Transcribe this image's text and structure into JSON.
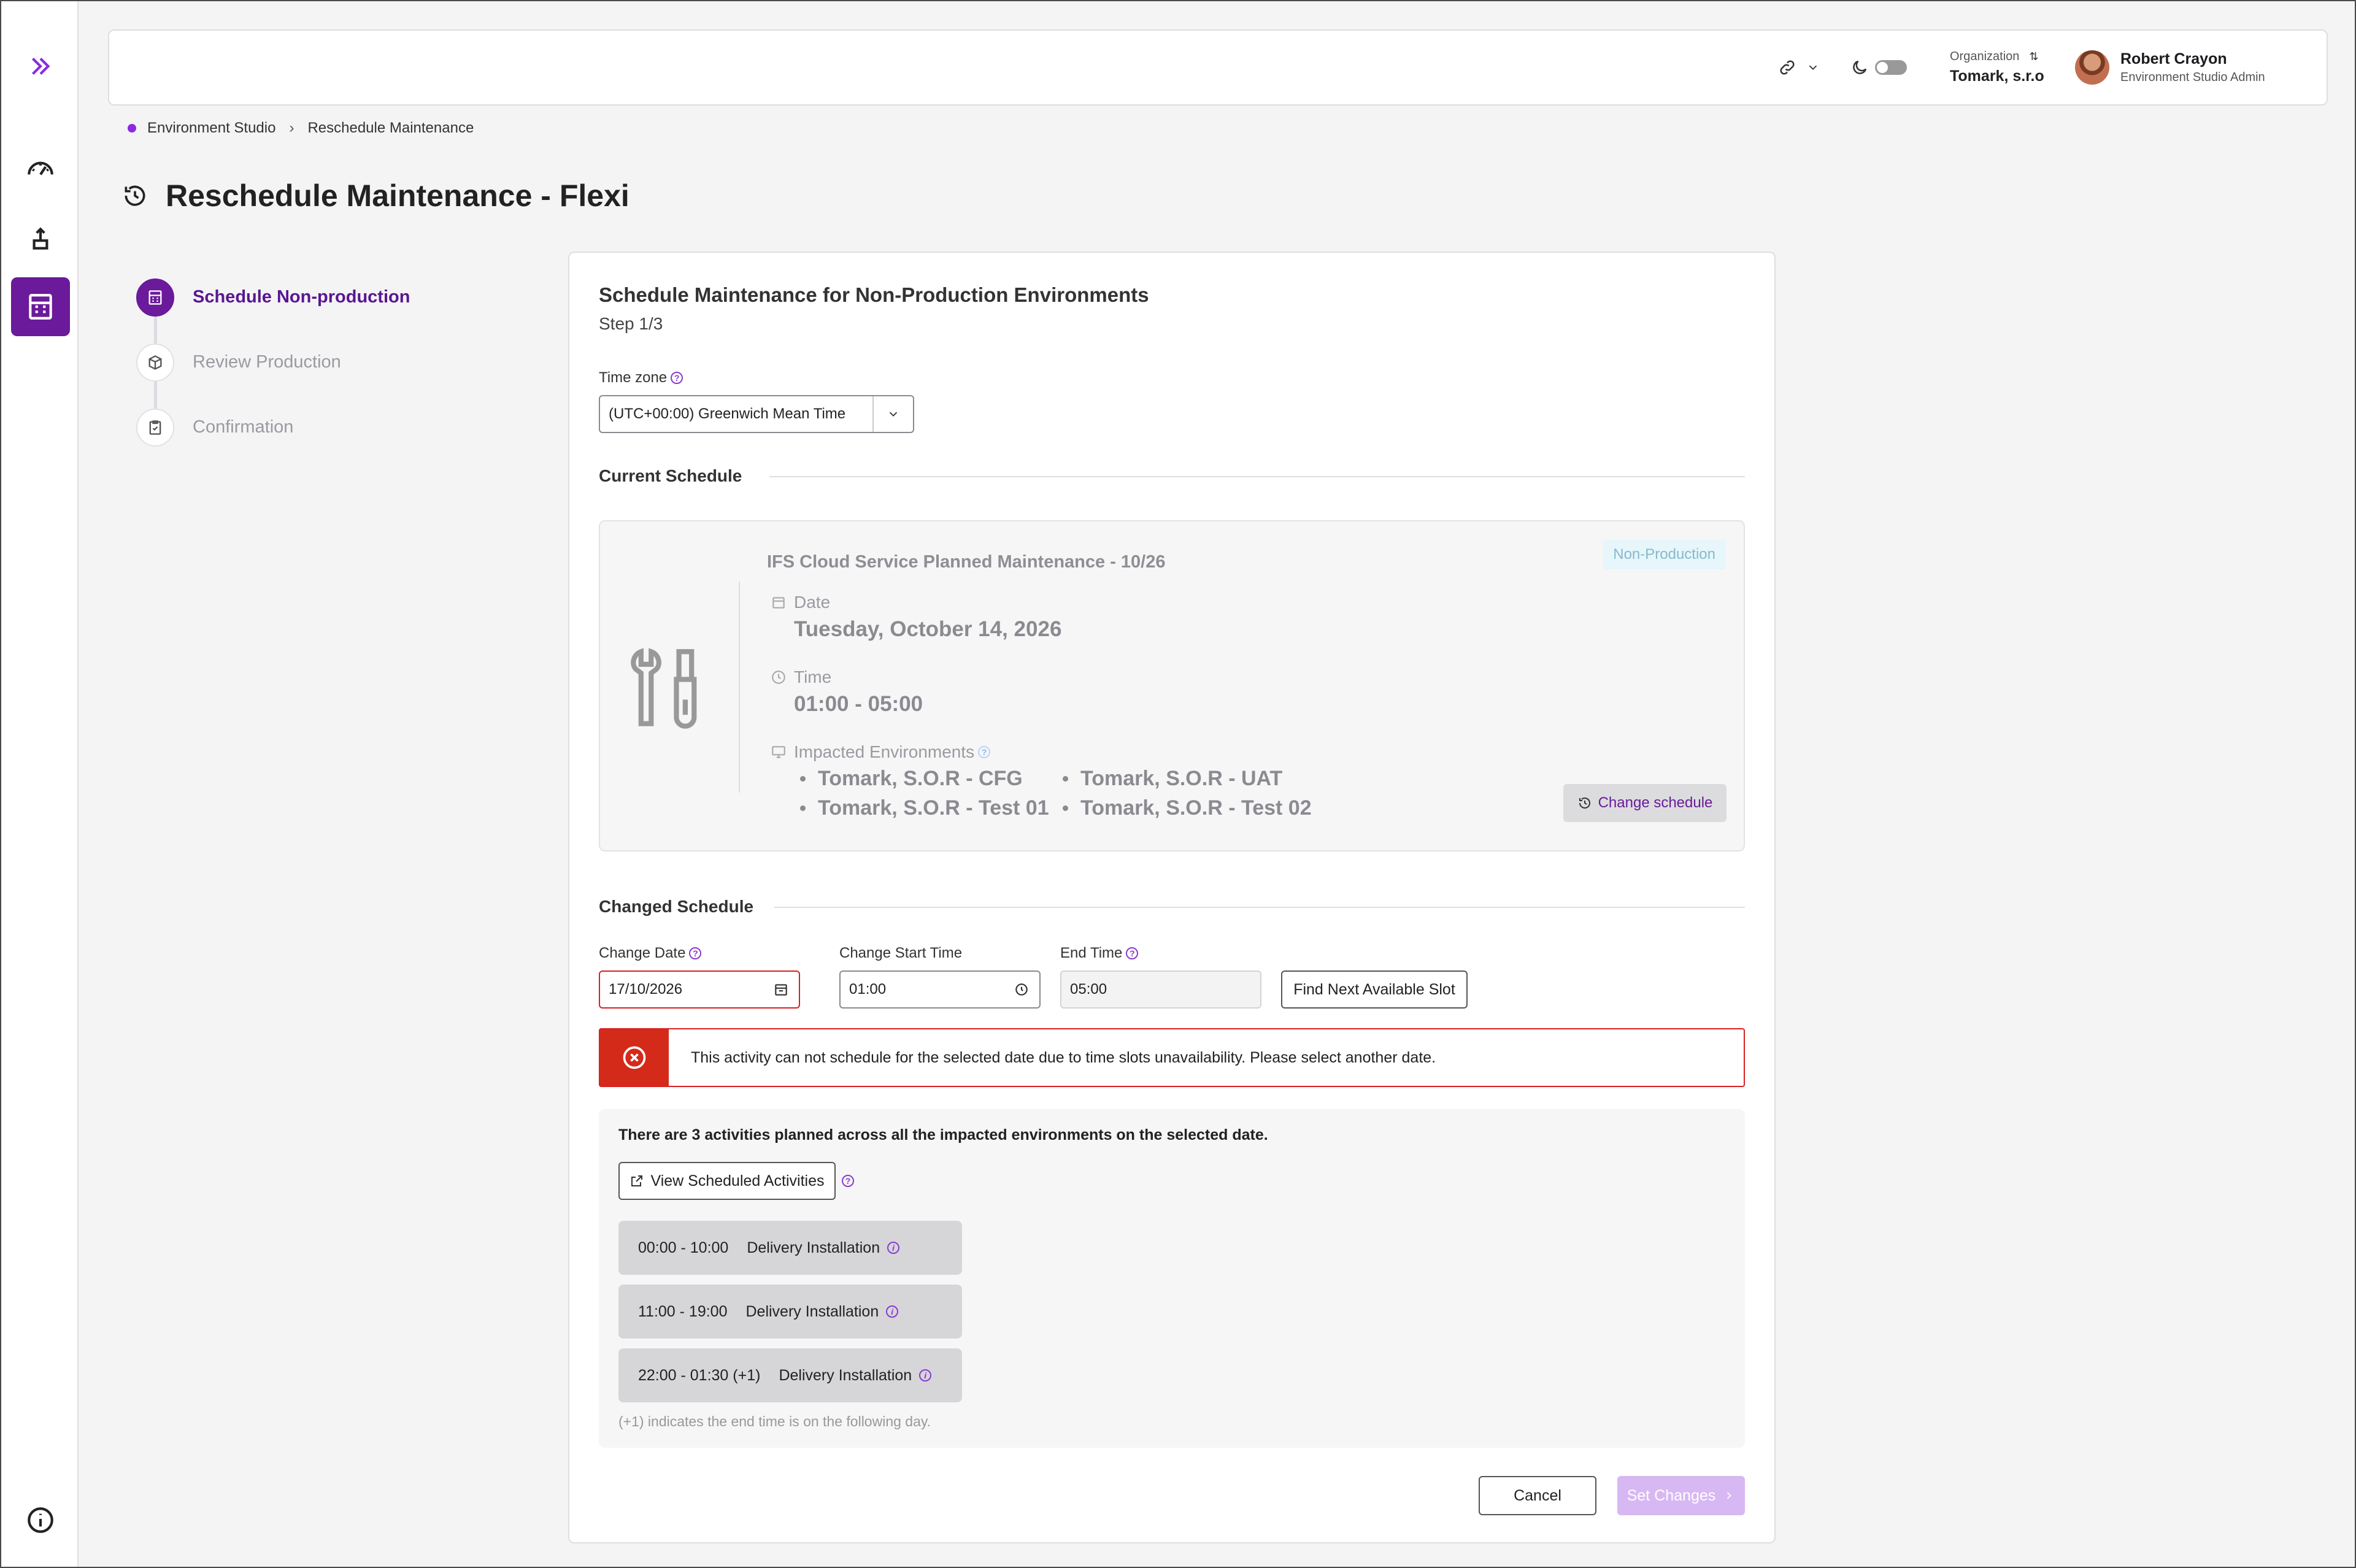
{
  "header": {
    "org_label": "Organization",
    "org_name": "Tomark, s.r.o",
    "user_name": "Robert Crayon",
    "user_role": "Environment Studio Admin"
  },
  "breadcrumb": {
    "root": "Environment Studio",
    "current": "Reschedule Maintenance"
  },
  "page": {
    "title": "Reschedule Maintenance - Flexi"
  },
  "steps": [
    {
      "label": "Schedule Non-production",
      "state": "active"
    },
    {
      "label": "Review Production",
      "state": "pending"
    },
    {
      "label": "Confirmation",
      "state": "pending"
    }
  ],
  "card": {
    "title": "Schedule Maintenance for Non-Production Environments",
    "step": "Step 1/3",
    "timezone_label": "Time zone",
    "timezone_value": "(UTC+00:00) Greenwich Mean Time"
  },
  "current": {
    "section_title": "Current Schedule",
    "maintenance_title": "IFS Cloud Service Planned Maintenance - 10/26",
    "badge": "Non-Production",
    "date_label": "Date",
    "date_value": "Tuesday, October 14, 2026",
    "time_label": "Time",
    "time_value": "01:00 - 05:00",
    "env_label": "Impacted Environments",
    "environments": [
      "Tomark, S.O.R - CFG",
      "Tomark, S.O.R - UAT",
      "Tomark, S.O.R - Test 01",
      "Tomark, S.O.R - Test 02"
    ],
    "change_button": "Change schedule"
  },
  "changed": {
    "section_title": "Changed Schedule",
    "date_label": "Change Date",
    "date_value": "17/10/2026",
    "start_label": "Change Start Time",
    "start_value": "01:00",
    "end_label": "End Time",
    "end_value": "05:00",
    "find_button": "Find Next Available Slot"
  },
  "error": {
    "message": "This activity can not schedule for the selected date due to time slots unavailability. Please select another date."
  },
  "activities": {
    "summary": "There are 3 activities planned across all the impacted environments on the selected date.",
    "view_button": "View Scheduled Activities",
    "slots": [
      {
        "time": "00:00 - 10:00",
        "name": "Delivery Installation"
      },
      {
        "time": "11:00 - 19:00",
        "name": "Delivery Installation"
      },
      {
        "time": "22:00 - 01:30 (+1)",
        "name": "Delivery Installation"
      }
    ],
    "note": "(+1) indicates the end time is on the following day."
  },
  "footer": {
    "cancel": "Cancel",
    "set_changes": "Set Changes"
  },
  "colors": {
    "accent": "#6a1a9a",
    "error": "#d42a1a",
    "disabled_button": "#d7b8f3"
  }
}
